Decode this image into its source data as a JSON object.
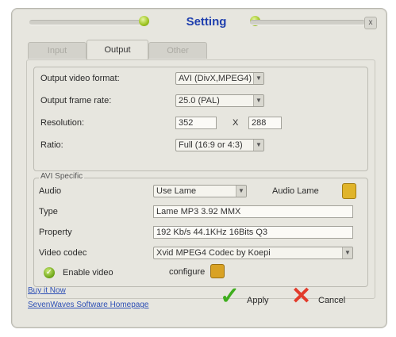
{
  "window": {
    "title": "Setting",
    "close_glyph": "x"
  },
  "tabs": [
    {
      "label": "Input",
      "active": false
    },
    {
      "label": "Output",
      "active": true
    },
    {
      "label": "Other",
      "active": false
    }
  ],
  "output": {
    "video_format_label": "Output video format:",
    "video_format_value": "AVI (DivX,MPEG4)",
    "frame_rate_label": "Output frame rate:",
    "frame_rate_value": "25.0 (PAL)",
    "resolution_label": "Resolution:",
    "resolution_width": "352",
    "resolution_sep": "X",
    "resolution_height": "288",
    "ratio_label": "Ratio:",
    "ratio_value": "Full (16:9 or 4:3)"
  },
  "avi_specific": {
    "legend": "AVI Specific",
    "audio_label": "Audio",
    "audio_value": "Use Lame",
    "audio_lame_label": "Audio Lame",
    "type_label": "Type",
    "type_value": "Lame MP3 3.92 MMX",
    "property_label": "Property",
    "property_value": "192 Kb/s 44.1KHz 16Bits Q3",
    "video_codec_label": "Video codec",
    "video_codec_value": "Xvid MPEG4 Codec by Koepi",
    "enable_video_label": "Enable video",
    "configure_label": "configure"
  },
  "footer": {
    "buy_link": "Buy it Now",
    "homepage_link": "SevenWaves Software Homepage",
    "apply_label": "Apply",
    "cancel_label": "Cancel"
  },
  "colors": {
    "accent_green": "#3fae1e",
    "cancel_red": "#e23b2b",
    "link_blue": "#2d4fb5",
    "title_blue": "#1f3fae"
  },
  "icons": [
    "green-knob-icon",
    "close-icon",
    "folder-icon",
    "green-check-icon",
    "apply-check-icon",
    "cancel-x-icon",
    "chevron-down-icon"
  ]
}
